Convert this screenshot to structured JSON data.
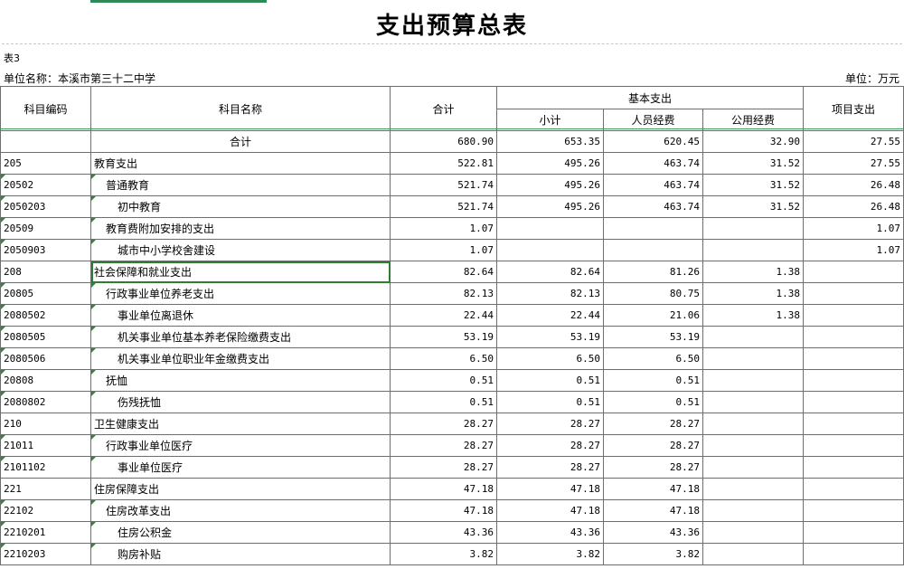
{
  "title": "支出预算总表",
  "table_no": "表3",
  "unit_name": "单位名称：本溪市第三十二中学",
  "unit": "单位：万元",
  "headers": {
    "code": "科目编码",
    "name": "科目名称",
    "total": "合计",
    "basic": "基本支出",
    "subtotal": "小计",
    "personnel": "人员经费",
    "public": "公用经费",
    "project": "项目支出"
  },
  "rows": [
    {
      "code": "",
      "name": "合计",
      "level": "total",
      "total": "680.90",
      "subtotal": "653.35",
      "personnel": "620.45",
      "public": "32.90",
      "project": "27.55"
    },
    {
      "code": "205",
      "name": "教育支出",
      "level": 0,
      "total": "522.81",
      "subtotal": "495.26",
      "personnel": "463.74",
      "public": "31.52",
      "project": "27.55"
    },
    {
      "code": "20502",
      "name": "普通教育",
      "level": 1,
      "total": "521.74",
      "subtotal": "495.26",
      "personnel": "463.74",
      "public": "31.52",
      "project": "26.48"
    },
    {
      "code": "2050203",
      "name": "初中教育",
      "level": 2,
      "total": "521.74",
      "subtotal": "495.26",
      "personnel": "463.74",
      "public": "31.52",
      "project": "26.48"
    },
    {
      "code": "20509",
      "name": "教育费附加安排的支出",
      "level": 1,
      "total": "1.07",
      "subtotal": "",
      "personnel": "",
      "public": "",
      "project": "1.07"
    },
    {
      "code": "2050903",
      "name": "城市中小学校舍建设",
      "level": 2,
      "total": "1.07",
      "subtotal": "",
      "personnel": "",
      "public": "",
      "project": "1.07"
    },
    {
      "code": "208",
      "name": "社会保障和就业支出",
      "level": 0,
      "total": "82.64",
      "subtotal": "82.64",
      "personnel": "81.26",
      "public": "1.38",
      "project": ""
    },
    {
      "code": "20805",
      "name": "行政事业单位养老支出",
      "level": 1,
      "total": "82.13",
      "subtotal": "82.13",
      "personnel": "80.75",
      "public": "1.38",
      "project": ""
    },
    {
      "code": "2080502",
      "name": "事业单位离退休",
      "level": 2,
      "total": "22.44",
      "subtotal": "22.44",
      "personnel": "21.06",
      "public": "1.38",
      "project": ""
    },
    {
      "code": "2080505",
      "name": "机关事业单位基本养老保险缴费支出",
      "level": 2,
      "total": "53.19",
      "subtotal": "53.19",
      "personnel": "53.19",
      "public": "",
      "project": ""
    },
    {
      "code": "2080506",
      "name": "机关事业单位职业年金缴费支出",
      "level": 2,
      "total": "6.50",
      "subtotal": "6.50",
      "personnel": "6.50",
      "public": "",
      "project": ""
    },
    {
      "code": "20808",
      "name": "抚恤",
      "level": 1,
      "total": "0.51",
      "subtotal": "0.51",
      "personnel": "0.51",
      "public": "",
      "project": ""
    },
    {
      "code": "2080802",
      "name": "伤残抚恤",
      "level": 2,
      "total": "0.51",
      "subtotal": "0.51",
      "personnel": "0.51",
      "public": "",
      "project": ""
    },
    {
      "code": "210",
      "name": "卫生健康支出",
      "level": 0,
      "total": "28.27",
      "subtotal": "28.27",
      "personnel": "28.27",
      "public": "",
      "project": ""
    },
    {
      "code": "21011",
      "name": "行政事业单位医疗",
      "level": 1,
      "total": "28.27",
      "subtotal": "28.27",
      "personnel": "28.27",
      "public": "",
      "project": ""
    },
    {
      "code": "2101102",
      "name": "事业单位医疗",
      "level": 2,
      "total": "28.27",
      "subtotal": "28.27",
      "personnel": "28.27",
      "public": "",
      "project": ""
    },
    {
      "code": "221",
      "name": "住房保障支出",
      "level": 0,
      "total": "47.18",
      "subtotal": "47.18",
      "personnel": "47.18",
      "public": "",
      "project": ""
    },
    {
      "code": "22102",
      "name": "住房改革支出",
      "level": 1,
      "total": "47.18",
      "subtotal": "47.18",
      "personnel": "47.18",
      "public": "",
      "project": ""
    },
    {
      "code": "2210201",
      "name": "住房公积金",
      "level": 2,
      "total": "43.36",
      "subtotal": "43.36",
      "personnel": "43.36",
      "public": "",
      "project": ""
    },
    {
      "code": "2210203",
      "name": "购房补贴",
      "level": 2,
      "total": "3.82",
      "subtotal": "3.82",
      "personnel": "3.82",
      "public": "",
      "project": ""
    }
  ],
  "colors": {
    "selection": "#2e7d32",
    "marker": "#1e8f3a"
  }
}
